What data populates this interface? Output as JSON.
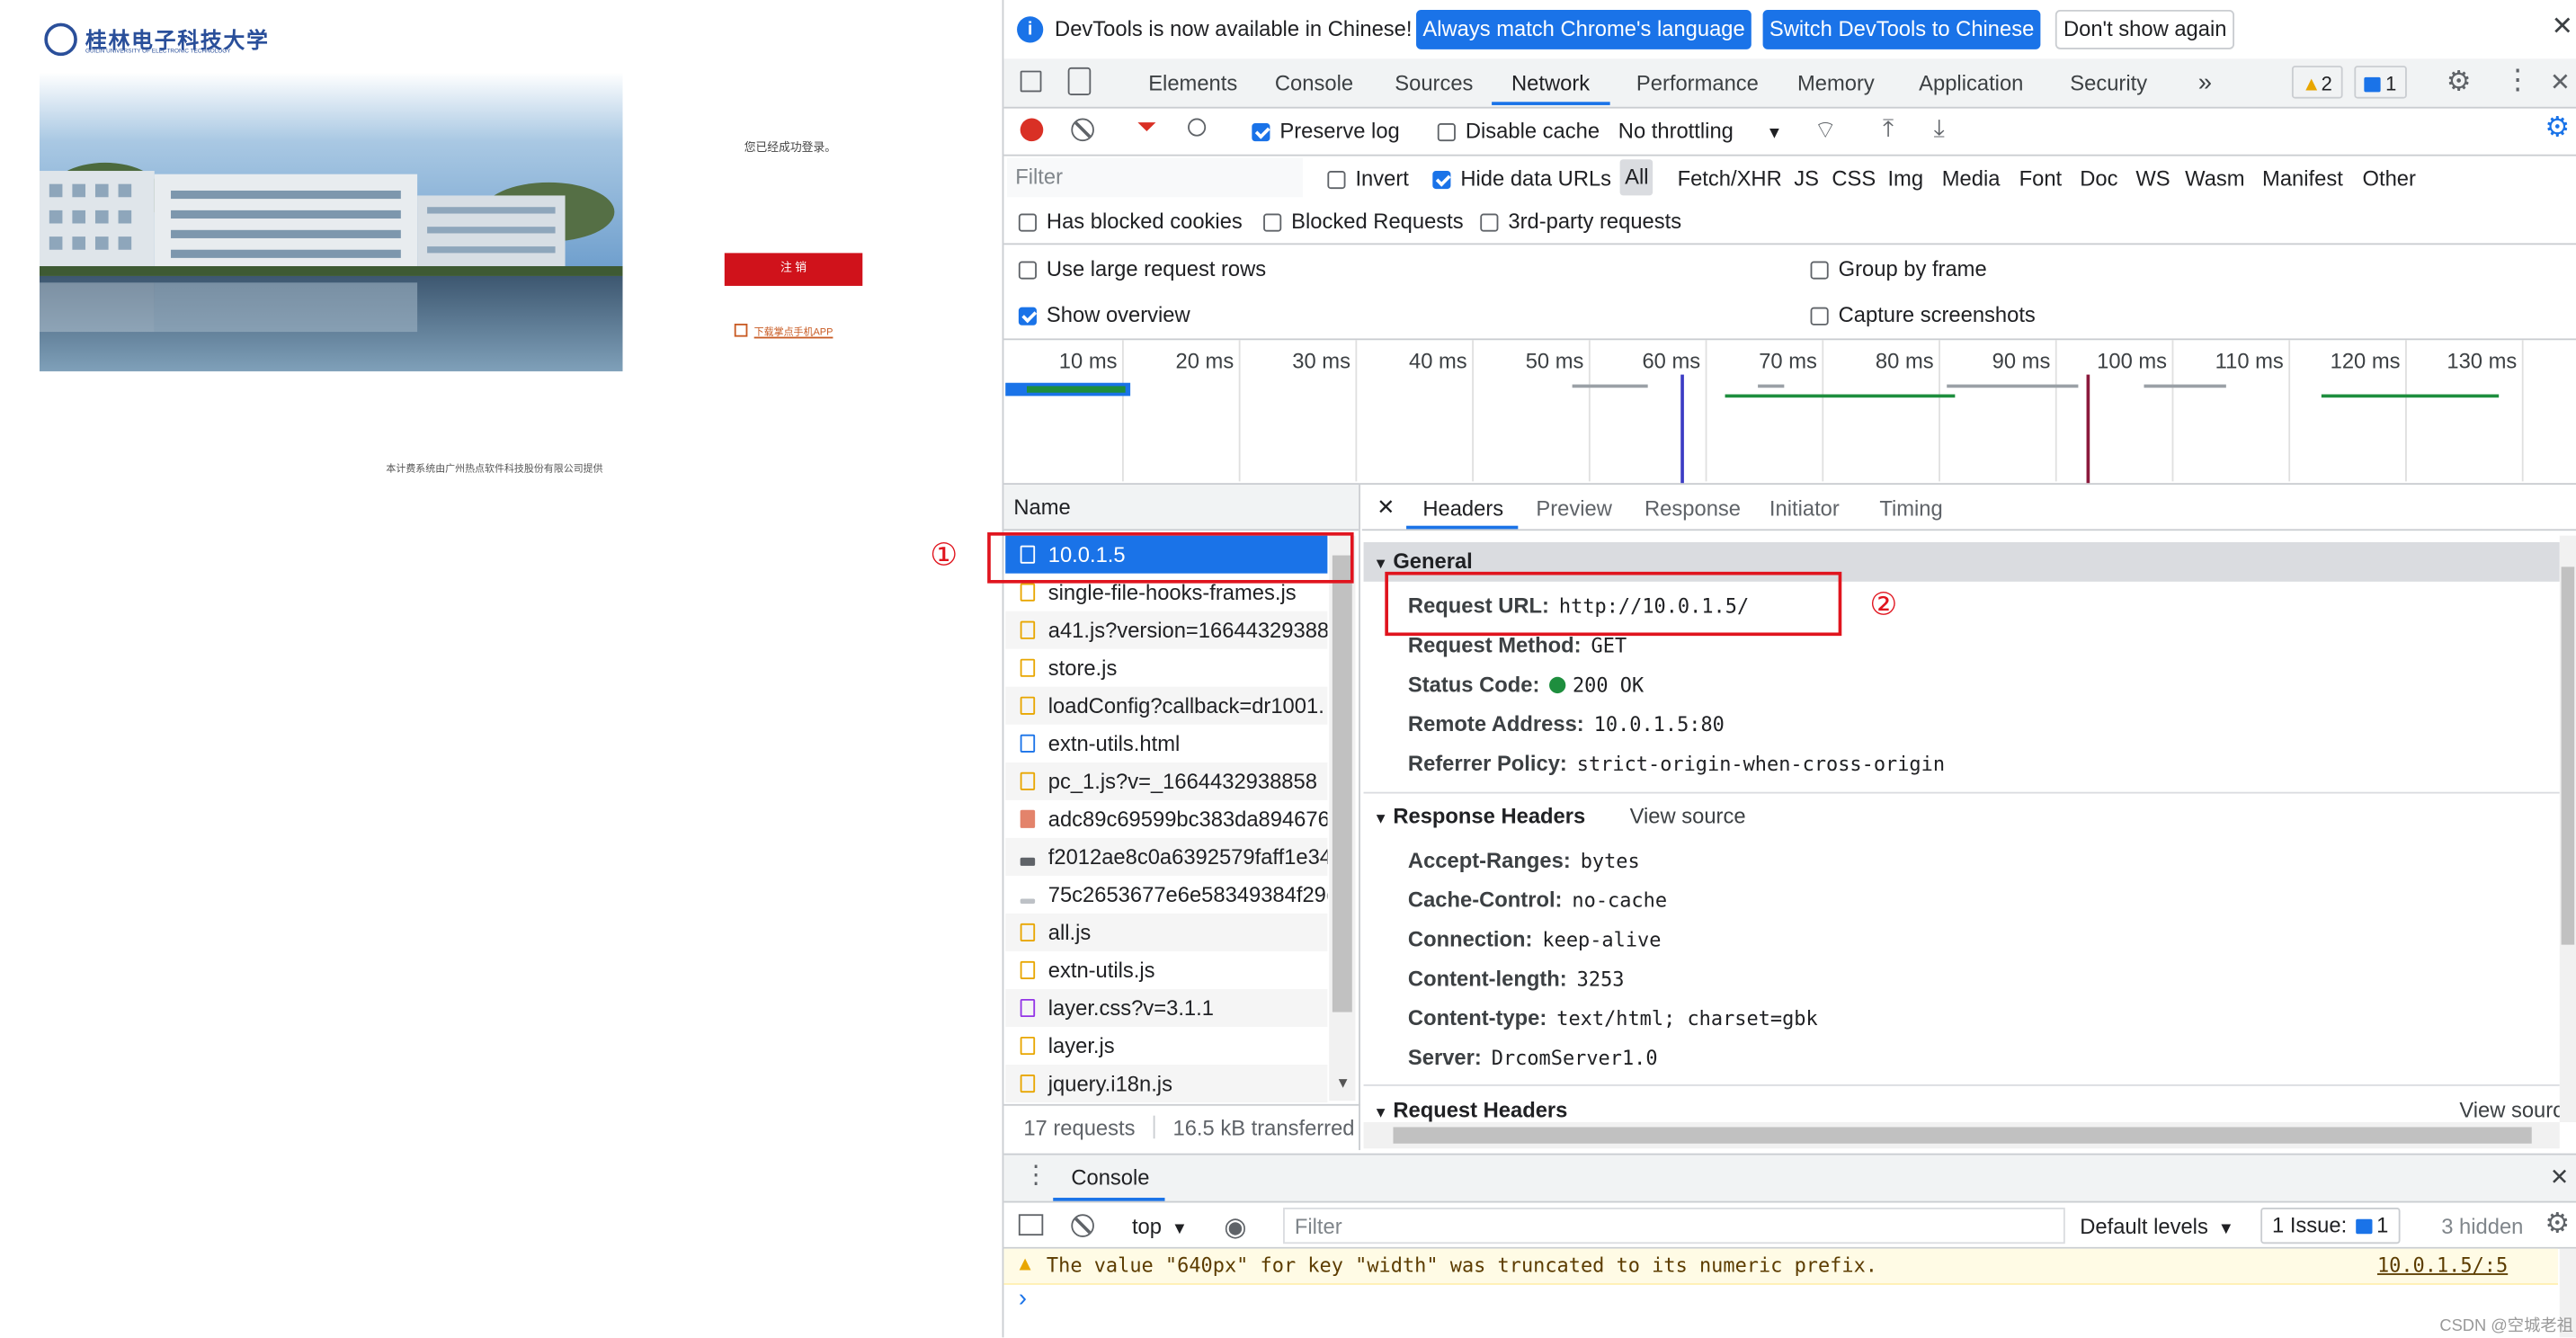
{
  "left_page": {
    "logo_text": "桂林电子科技大学",
    "logo_sub": "GUILIN UNIVERSITY OF ELECTRONIC TECHNOLOGY",
    "status_msg": "您已经成功登录。",
    "logout_btn": "注 销",
    "app_link": "下载掌点手机APP",
    "footer": "本计费系统由广州热点软件科技股份有限公司提供"
  },
  "annotations": {
    "marker1": "①",
    "marker2": "②"
  },
  "devtools": {
    "infobar": {
      "text": "DevTools is now available in Chinese!",
      "btn1": "Always match Chrome's language",
      "btn2": "Switch DevTools to Chinese",
      "btn3": "Don't show again"
    },
    "tabs": [
      "Elements",
      "Console",
      "Sources",
      "Network",
      "Performance",
      "Memory",
      "Application",
      "Security"
    ],
    "warn_count": "2",
    "msg_count": "1",
    "toolbar": {
      "preserve_log": "Preserve log",
      "disable_cache": "Disable cache",
      "throttling": "No throttling"
    },
    "filter": {
      "placeholder": "Filter",
      "invert": "Invert",
      "hide_data_urls": "Hide data URLs",
      "types": [
        "All",
        "Fetch/XHR",
        "JS",
        "CSS",
        "Img",
        "Media",
        "Font",
        "Doc",
        "WS",
        "Wasm",
        "Manifest",
        "Other"
      ],
      "has_blocked": "Has blocked cookies",
      "blocked_requests": "Blocked Requests",
      "third_party": "3rd-party requests"
    },
    "options": {
      "large_rows": "Use large request rows",
      "group_frame": "Group by frame",
      "show_overview": "Show overview",
      "capture": "Capture screenshots"
    },
    "ticks": [
      "10 ms",
      "20 ms",
      "30 ms",
      "40 ms",
      "50 ms",
      "60 ms",
      "70 ms",
      "80 ms",
      "90 ms",
      "100 ms",
      "110 ms",
      "120 ms",
      "130 ms"
    ],
    "name_header": "Name",
    "requests": [
      "10.0.1.5",
      "single-file-hooks-frames.js",
      "a41.js?version=1664432938856",
      "store.js",
      "loadConfig?callback=dr1001.",
      "extn-utils.html",
      "pc_1.js?v=_1664432938858",
      "adc89c69599bc383da894676.",
      "f2012ae8c0a6392579faff1e34",
      "75c2653677e6e58349384f29c",
      "all.js",
      "extn-utils.js",
      "layer.css?v=3.1.1",
      "layer.js",
      "jquery.i18n.js"
    ],
    "summary": {
      "requests": "17 requests",
      "transferred": "16.5 kB transferred"
    },
    "detail_tabs": [
      "Headers",
      "Preview",
      "Response",
      "Initiator",
      "Timing"
    ],
    "general": {
      "title": "General",
      "rows": [
        {
          "k": "Request URL:",
          "v": "http://10.0.1.5/"
        },
        {
          "k": "Request Method:",
          "v": "GET"
        },
        {
          "k": "Status Code:",
          "v": "200 OK"
        },
        {
          "k": "Remote Address:",
          "v": "10.0.1.5:80"
        },
        {
          "k": "Referrer Policy:",
          "v": "strict-origin-when-cross-origin"
        }
      ]
    },
    "response_headers": {
      "title": "Response Headers",
      "view_source": "View source",
      "rows": [
        {
          "k": "Accept-Ranges:",
          "v": "bytes"
        },
        {
          "k": "Cache-Control:",
          "v": "no-cache"
        },
        {
          "k": "Connection:",
          "v": "keep-alive"
        },
        {
          "k": "Content-length:",
          "v": "3253"
        },
        {
          "k": "Content-type:",
          "v": "text/html; charset=gbk"
        },
        {
          "k": "Server:",
          "v": "DrcomServer1.0"
        }
      ]
    },
    "request_headers": {
      "title": "Request Headers",
      "view_source": "View sourc"
    },
    "console": {
      "tab": "Console",
      "context": "top",
      "filter_placeholder": "Filter",
      "levels": "Default levels",
      "issues": "1 Issue:",
      "issue_count": "1",
      "hidden": "3 hidden",
      "warning": "The value \"640px\" for key \"width\" was truncated to its numeric prefix.",
      "warning_src": "10.0.1.5/:5",
      "prompt": "›"
    },
    "watermark": "CSDN @空城老祖"
  }
}
